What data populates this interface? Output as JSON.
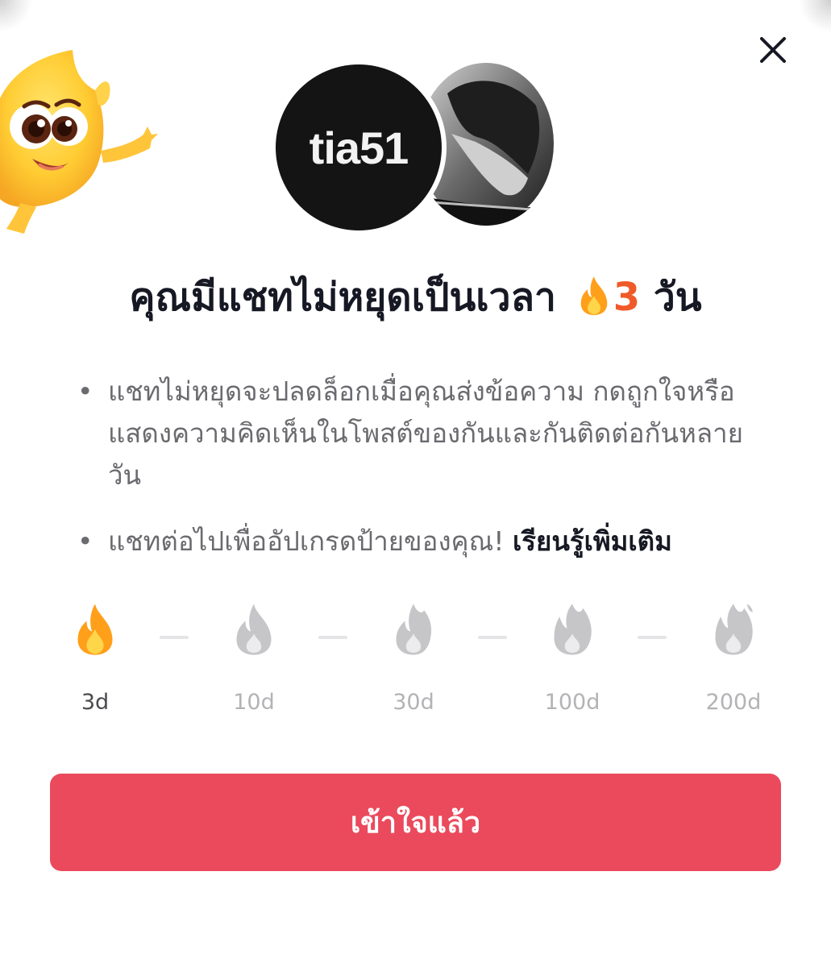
{
  "colors": {
    "accent": "#ea4a5c",
    "streak_number": "#f05a28",
    "inactive": "#b3b3b6"
  },
  "header": {
    "close_icon": "close-icon"
  },
  "avatars": {
    "left_logo_text": "tia51",
    "right_icon": "profile-photo"
  },
  "title": {
    "prefix": "คุณมีแชทไม่หยุดเป็นเวลา",
    "flame_icon": "flame-icon",
    "days": "3",
    "suffix": "วัน"
  },
  "bullets": [
    {
      "text": "แชทไม่หยุดจะปลดล็อกเมื่อคุณส่งข้อความ กดถูกใจหรือแสดงความคิดเห็นในโพสต์ของกันและกันติดต่อกันหลายวัน"
    },
    {
      "text": "แชทต่อไปเพื่ออัปเกรดป้ายของคุณ!",
      "link": "เรียนรู้เพิ่มเติม"
    }
  ],
  "milestones": [
    {
      "label": "3d",
      "active": true,
      "icon": "flame-icon"
    },
    {
      "label": "10d",
      "active": false,
      "icon": "flame-icon"
    },
    {
      "label": "30d",
      "active": false,
      "icon": "flame-icon"
    },
    {
      "label": "100d",
      "active": false,
      "icon": "flame-icon"
    },
    {
      "label": "200d",
      "active": false,
      "icon": "flame-icon"
    }
  ],
  "cta": {
    "label": "เข้าใจแล้ว"
  }
}
